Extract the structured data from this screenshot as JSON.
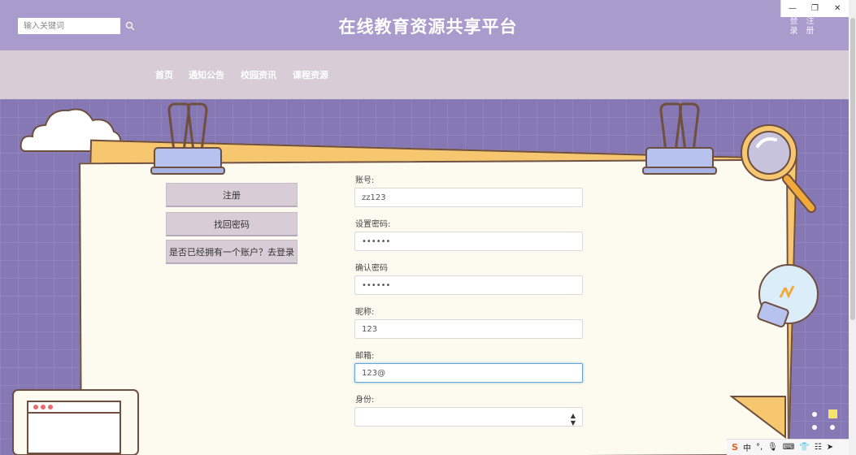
{
  "header": {
    "title": "在线教育资源共享平台",
    "auth_links": [
      "登录",
      "注册"
    ]
  },
  "window_controls": {
    "minimize": "—",
    "restore": "❐",
    "close": "✕"
  },
  "nav": {
    "search_placeholder": "输入关键词",
    "links": [
      "首页",
      "通知公告",
      "校园资讯",
      "课程资源"
    ]
  },
  "side_buttons": [
    "注册",
    "找回密码",
    "是否已经拥有一个账户？去登录"
  ],
  "form": {
    "account": {
      "label": "账号:",
      "value": "zz123"
    },
    "password": {
      "label": "设置密码:",
      "value": "••••••"
    },
    "confirm": {
      "label": "确认密码",
      "value": "••••••"
    },
    "nickname": {
      "label": "昵称:",
      "value": "123"
    },
    "email": {
      "label": "邮箱:",
      "value": "123@"
    },
    "role": {
      "label": "身份:",
      "value": ""
    }
  },
  "tray": {
    "ime_icon": "S",
    "ime_mode": "中",
    "items": [
      "°,",
      "🎙",
      "⌨",
      "👕",
      "☷",
      "➤"
    ]
  },
  "colors": {
    "header": "#a99bcb",
    "nav": "#d8cdd7",
    "background": "#8678b5",
    "paper": "#fdfbf0",
    "focus": "#66a6d6"
  }
}
